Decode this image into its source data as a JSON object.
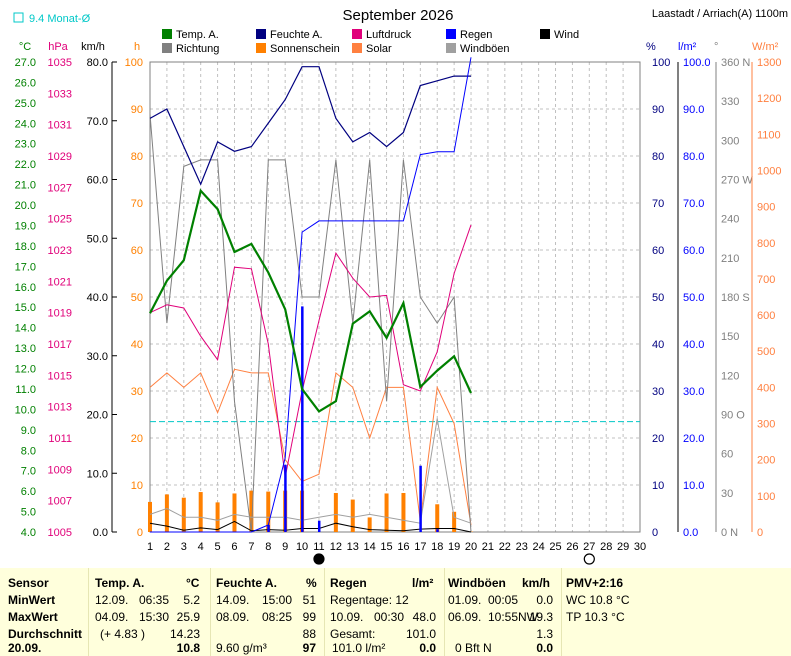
{
  "header": {
    "title": "September 2026",
    "location": "Laastadt / Arriach(A) 1100m",
    "avg_label": "9.4 Monat-Ø"
  },
  "legend": [
    {
      "label": "Temp. A.",
      "color": "#008000"
    },
    {
      "label": "Feuchte A.",
      "color": "#000080"
    },
    {
      "label": "Luftdruck",
      "color": "#e0007a"
    },
    {
      "label": "Regen",
      "color": "#0000ff"
    },
    {
      "label": "Wind",
      "color": "#000000"
    },
    {
      "label": "Richtung",
      "color": "#808080"
    },
    {
      "label": "Sonnenschein",
      "color": "#ff8000"
    },
    {
      "label": "Solar",
      "color": "#ff8040"
    },
    {
      "label": "Windböen",
      "color": "#a0a0a0"
    }
  ],
  "axes": {
    "temp": {
      "unit": "°C",
      "color": "#008000",
      "ticks": [
        "27.0",
        "26.0",
        "25.0",
        "24.0",
        "23.0",
        "22.0",
        "21.0",
        "20.0",
        "19.0",
        "18.0",
        "17.0",
        "16.0",
        "15.0",
        "14.0",
        "13.0",
        "12.0",
        "11.0",
        "10.0",
        "9.0",
        "8.0",
        "7.0",
        "6.0",
        "5.0",
        "4.0"
      ]
    },
    "pressure": {
      "unit": "hPa",
      "color": "#e0007a",
      "ticks": [
        "1035",
        "1033",
        "1031",
        "1029",
        "1027",
        "1025",
        "1023",
        "1021",
        "1019",
        "1017",
        "1015",
        "1013",
        "1011",
        "1009",
        "1007",
        "1005"
      ]
    },
    "wind": {
      "unit": "km/h",
      "color": "#000000",
      "ticks": [
        "80.0",
        "70.0",
        "60.0",
        "50.0",
        "40.0",
        "30.0",
        "20.0",
        "10.0",
        "0.0"
      ]
    },
    "sun": {
      "unit": "h",
      "color": "#ff8000",
      "ticks": [
        "100",
        "90",
        "80",
        "70",
        "60",
        "50",
        "40",
        "30",
        "20",
        "10",
        "0"
      ]
    },
    "humidity": {
      "unit": "%",
      "color": "#000080",
      "ticks": [
        "100",
        "90",
        "80",
        "70",
        "60",
        "50",
        "40",
        "30",
        "20",
        "10",
        "0"
      ]
    },
    "rain": {
      "unit": "l/m²",
      "color": "#0000ff",
      "ticks": [
        "100.0",
        "90.0",
        "80.0",
        "70.0",
        "60.0",
        "50.0",
        "40.0",
        "30.0",
        "20.0",
        "10.0",
        "0.0"
      ]
    },
    "direction": {
      "unit": "°",
      "color": "#808080",
      "ticks": [
        "360 N",
        "330",
        "300",
        "270 W",
        "240",
        "210",
        "180 S",
        "150",
        "120",
        "90 O",
        "60",
        "30",
        "0 N"
      ]
    },
    "solar": {
      "unit": "W/m²",
      "color": "#ff8040",
      "ticks": [
        "1300",
        "1200",
        "1100",
        "1000",
        "900",
        "800",
        "700",
        "600",
        "500",
        "400",
        "300",
        "200",
        "100",
        "0"
      ]
    },
    "days": [
      "1",
      "2",
      "3",
      "4",
      "5",
      "6",
      "7",
      "8",
      "9",
      "10",
      "11",
      "12",
      "13",
      "14",
      "15",
      "16",
      "17",
      "18",
      "19",
      "20",
      "21",
      "22",
      "23",
      "24",
      "25",
      "26",
      "27",
      "28",
      "29",
      "30"
    ]
  },
  "chart_data": {
    "type": "line",
    "title": "September 2026",
    "x": [
      1,
      2,
      3,
      4,
      5,
      6,
      7,
      8,
      9,
      10,
      11,
      12,
      13,
      14,
      15,
      16,
      17,
      18,
      19,
      20
    ],
    "series": [
      {
        "name": "Temp. A.",
        "unit": "°C",
        "values": [
          14.7,
          16.3,
          17.3,
          20.7,
          19.8,
          17.7,
          18.1,
          16.7,
          14.9,
          11.0,
          9.9,
          10.4,
          14.2,
          14.8,
          13.5,
          15.2,
          11.1,
          11.9,
          12.6,
          10.8
        ]
      },
      {
        "name": "Feuchte A.",
        "unit": "%",
        "values": [
          88,
          90,
          82,
          74,
          83,
          81,
          82,
          87,
          92,
          99,
          99,
          88,
          83,
          85,
          82,
          85,
          95,
          96,
          97,
          97
        ]
      },
      {
        "name": "Luftdruck",
        "unit": "hPa",
        "values": [
          1019.0,
          1019.5,
          1019.3,
          1017.5,
          1016.0,
          1021.9,
          1021.8,
          1017.0,
          1008.5,
          1014.0,
          1018.5,
          1022.8,
          1021.2,
          1020.0,
          1020.1,
          1014.4,
          1014.0,
          1016.5,
          1021.5,
          1024.6
        ]
      },
      {
        "name": "Regen",
        "unit": "l/m²",
        "values": [
          0,
          0,
          0,
          0,
          0,
          0,
          0,
          1.5,
          14.3,
          48.0,
          2.4,
          0,
          0,
          0,
          0,
          0,
          14.1,
          0.6,
          0,
          0
        ]
      },
      {
        "name": "Regen kumuliert",
        "unit": "l/m²",
        "values": [
          0,
          0,
          0,
          0,
          0,
          0,
          0,
          1.5,
          15.8,
          63.8,
          66.2,
          66.2,
          66.2,
          66.2,
          66.2,
          66.2,
          80.3,
          80.9,
          80.9,
          101.0
        ]
      },
      {
        "name": "Sonnenschein",
        "unit": "h",
        "values": [
          6.4,
          8.0,
          7.3,
          8.5,
          6.3,
          8.2,
          8.8,
          8.6,
          8.8,
          8.8,
          0,
          8.3,
          6.9,
          3.1,
          8.2,
          8.3,
          0,
          5.9,
          4.3,
          0.1
        ]
      },
      {
        "name": "Solar",
        "unit": "W/m²",
        "values": [
          400,
          440,
          400,
          440,
          330,
          450,
          440,
          440,
          200,
          140,
          160,
          440,
          400,
          260,
          400,
          400,
          30,
          400,
          300,
          20
        ]
      },
      {
        "name": "Wind",
        "unit": "km/h",
        "values": [
          1.5,
          1.0,
          0.3,
          0.7,
          0.4,
          1.8,
          0.2,
          0.4,
          0.3,
          0.6,
          0.6,
          1.5,
          0.9,
          0.4,
          0.3,
          0.2,
          0.5,
          0.6,
          0.6,
          0.0
        ]
      },
      {
        "name": "Windböen",
        "unit": "km/h",
        "values": [
          3.0,
          4.0,
          2.5,
          2.5,
          2.0,
          3.0,
          2.5,
          2.5,
          2.5,
          2.0,
          2.5,
          3.0,
          2.5,
          3.0,
          2.5,
          2.0,
          1.5,
          19.3,
          2.5,
          1.5
        ]
      },
      {
        "name": "Richtung",
        "unit": "°",
        "values": [
          320,
          160,
          280,
          285,
          285,
          100,
          0,
          285,
          285,
          180,
          180,
          285,
          160,
          285,
          100,
          285,
          180,
          160,
          180,
          0
        ]
      }
    ],
    "reference_lines": [
      {
        "name": "9.4 Monat-Ø",
        "unit": "°C",
        "value": 9.4
      }
    ],
    "markers": [
      {
        "type": "new-moon",
        "x": 11
      },
      {
        "type": "full-moon",
        "x": 27
      }
    ],
    "xlim": [
      1,
      30
    ],
    "grid": true
  },
  "stats": {
    "row_labels": [
      "Sensor",
      "MinWert",
      "MaxWert",
      "Durchschnitt",
      "20.09."
    ],
    "temp": {
      "title": "Temp. A.",
      "unit": "°C",
      "min_date": "12.09.",
      "min_time": "06:35",
      "min": "5.2",
      "max_date": "04.09.",
      "max_time": "15:30",
      "max": "25.9",
      "avg_extra": "(+ 4.83 )",
      "avg": "14.23",
      "today": "10.8"
    },
    "humidity": {
      "title": "Feuchte A.",
      "unit": "%",
      "min_date": "14.09.",
      "min_time": "15:00",
      "min": "51",
      "max_date": "08.09.",
      "max_time": "08:25",
      "max": "99",
      "avg": "88",
      "today_extra": "9.60 g/m³",
      "today": "97"
    },
    "rain": {
      "title": "Regen",
      "unit": "l/m²",
      "days_label": "Regentage: 12",
      "max_date": "10.09.",
      "max_time": "00:30",
      "max": "48.0",
      "total_label": "Gesamt:",
      "total": "101.0",
      "today_extra": "101.0 l/m²",
      "today": "0.0"
    },
    "gust": {
      "title": "Windböen",
      "unit": "km/h",
      "min_date": "01.09.",
      "min_time": "00:05",
      "min": "0.0",
      "max_date": "06.09.",
      "max_time": "10:55",
      "max_dir": "NW",
      "max": "19.3",
      "avg": "1.3",
      "today_extra": "0 Bft N",
      "today": "0.0"
    },
    "pmv": {
      "title": "PMV+2:16",
      "wc": "WC 10.8 °C",
      "tp": "TP 10.3 °C"
    }
  }
}
